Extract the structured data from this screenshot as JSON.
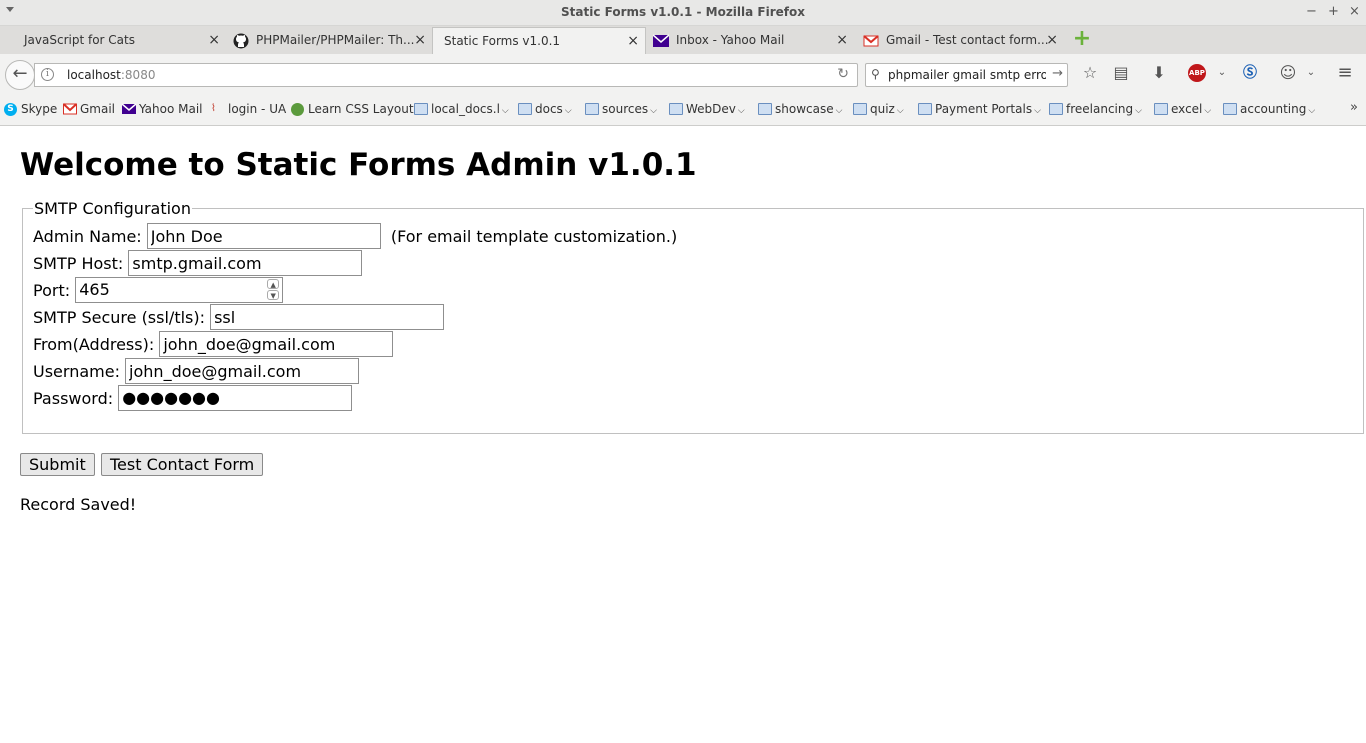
{
  "window": {
    "title": "Static Forms v1.0.1 - Mozilla Firefox",
    "controls": [
      "−",
      "+",
      "×"
    ]
  },
  "tabs": [
    {
      "label": "JavaScript for Cats",
      "icon": "none"
    },
    {
      "label": "PHPMailer/PHPMailer: Th...",
      "icon": "github-icon"
    },
    {
      "label": "Static Forms v1.0.1",
      "icon": "none",
      "active": true
    },
    {
      "label": "Inbox - Yahoo Mail",
      "icon": "yahoo-mail-icon"
    },
    {
      "label": "Gmail - Test contact form...",
      "icon": "gmail-icon"
    }
  ],
  "navbar": {
    "url_host": "localhost",
    "url_port": ":8080",
    "search_value": "phpmailer gmail smtp error p"
  },
  "bookmarks": [
    {
      "label": "Skype",
      "icon": "skype-icon",
      "folder": false
    },
    {
      "label": "Gmail",
      "icon": "gmail-icon",
      "folder": false
    },
    {
      "label": "Yahoo Mail",
      "icon": "yahoo-mail-icon",
      "folder": false
    },
    {
      "label": "login - UA",
      "icon": "ua-icon",
      "folder": false
    },
    {
      "label": "Learn CSS Layout",
      "icon": "css-icon",
      "folder": false
    },
    {
      "label": "local_docs.l",
      "icon": "folder-icon",
      "folder": true
    },
    {
      "label": "docs",
      "icon": "folder-icon",
      "folder": true
    },
    {
      "label": "sources",
      "icon": "folder-icon",
      "folder": true
    },
    {
      "label": "WebDev",
      "icon": "folder-icon",
      "folder": true
    },
    {
      "label": "showcase",
      "icon": "folder-icon",
      "folder": true
    },
    {
      "label": "quiz",
      "icon": "folder-icon",
      "folder": true
    },
    {
      "label": "Payment Portals",
      "icon": "folder-icon",
      "folder": true
    },
    {
      "label": "freelancing",
      "icon": "folder-icon",
      "folder": true
    },
    {
      "label": "excel",
      "icon": "folder-icon",
      "folder": true
    },
    {
      "label": "accounting",
      "icon": "folder-icon",
      "folder": true
    }
  ],
  "page": {
    "heading": "Welcome to Static Forms Admin v1.0.1",
    "fieldset_legend": "SMTP Configuration",
    "admin_name_label": "Admin Name:",
    "admin_name_value": "John Doe",
    "admin_name_hint": "(For email template customization.)",
    "smtp_host_label": "SMTP Host:",
    "smtp_host_value": "smtp.gmail.com",
    "port_label": "Port:",
    "port_value": "465",
    "secure_label": "SMTP Secure (ssl/tls):",
    "secure_value": "ssl",
    "from_label": "From(Address):",
    "from_value": "john_doe@gmail.com",
    "username_label": "Username:",
    "username_value": "john_doe@gmail.com",
    "password_label": "Password:",
    "password_mask": "●●●●●●●",
    "submit_label": "Submit",
    "test_label": "Test Contact Form",
    "status_message": "Record Saved!"
  },
  "colors": {
    "abp_red": "#c0171a",
    "newtab_green": "#6bb23b",
    "yahoo_purple": "#400090",
    "gmail_red": "#d93025"
  }
}
